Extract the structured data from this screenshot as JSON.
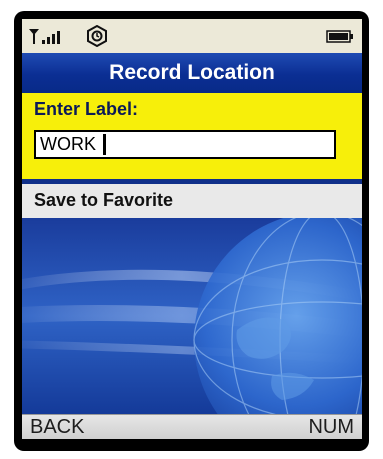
{
  "status_bar": {
    "icons": [
      "signal-strength-icon",
      "alarm-icon",
      "battery-icon"
    ]
  },
  "title_bar": {
    "title": "Record Location"
  },
  "label_panel": {
    "heading": "Enter Label:",
    "input_value": "WORK"
  },
  "menu": {
    "items": [
      {
        "label": "Save to Favorite"
      }
    ]
  },
  "softkeys": {
    "left": "BACK",
    "right": "NUM"
  },
  "colors": {
    "title_bar": "#0b2e93",
    "label_panel": "#f7ef0a",
    "menu_item": "#e9e9e9",
    "status_bar": "#ece9d8"
  }
}
